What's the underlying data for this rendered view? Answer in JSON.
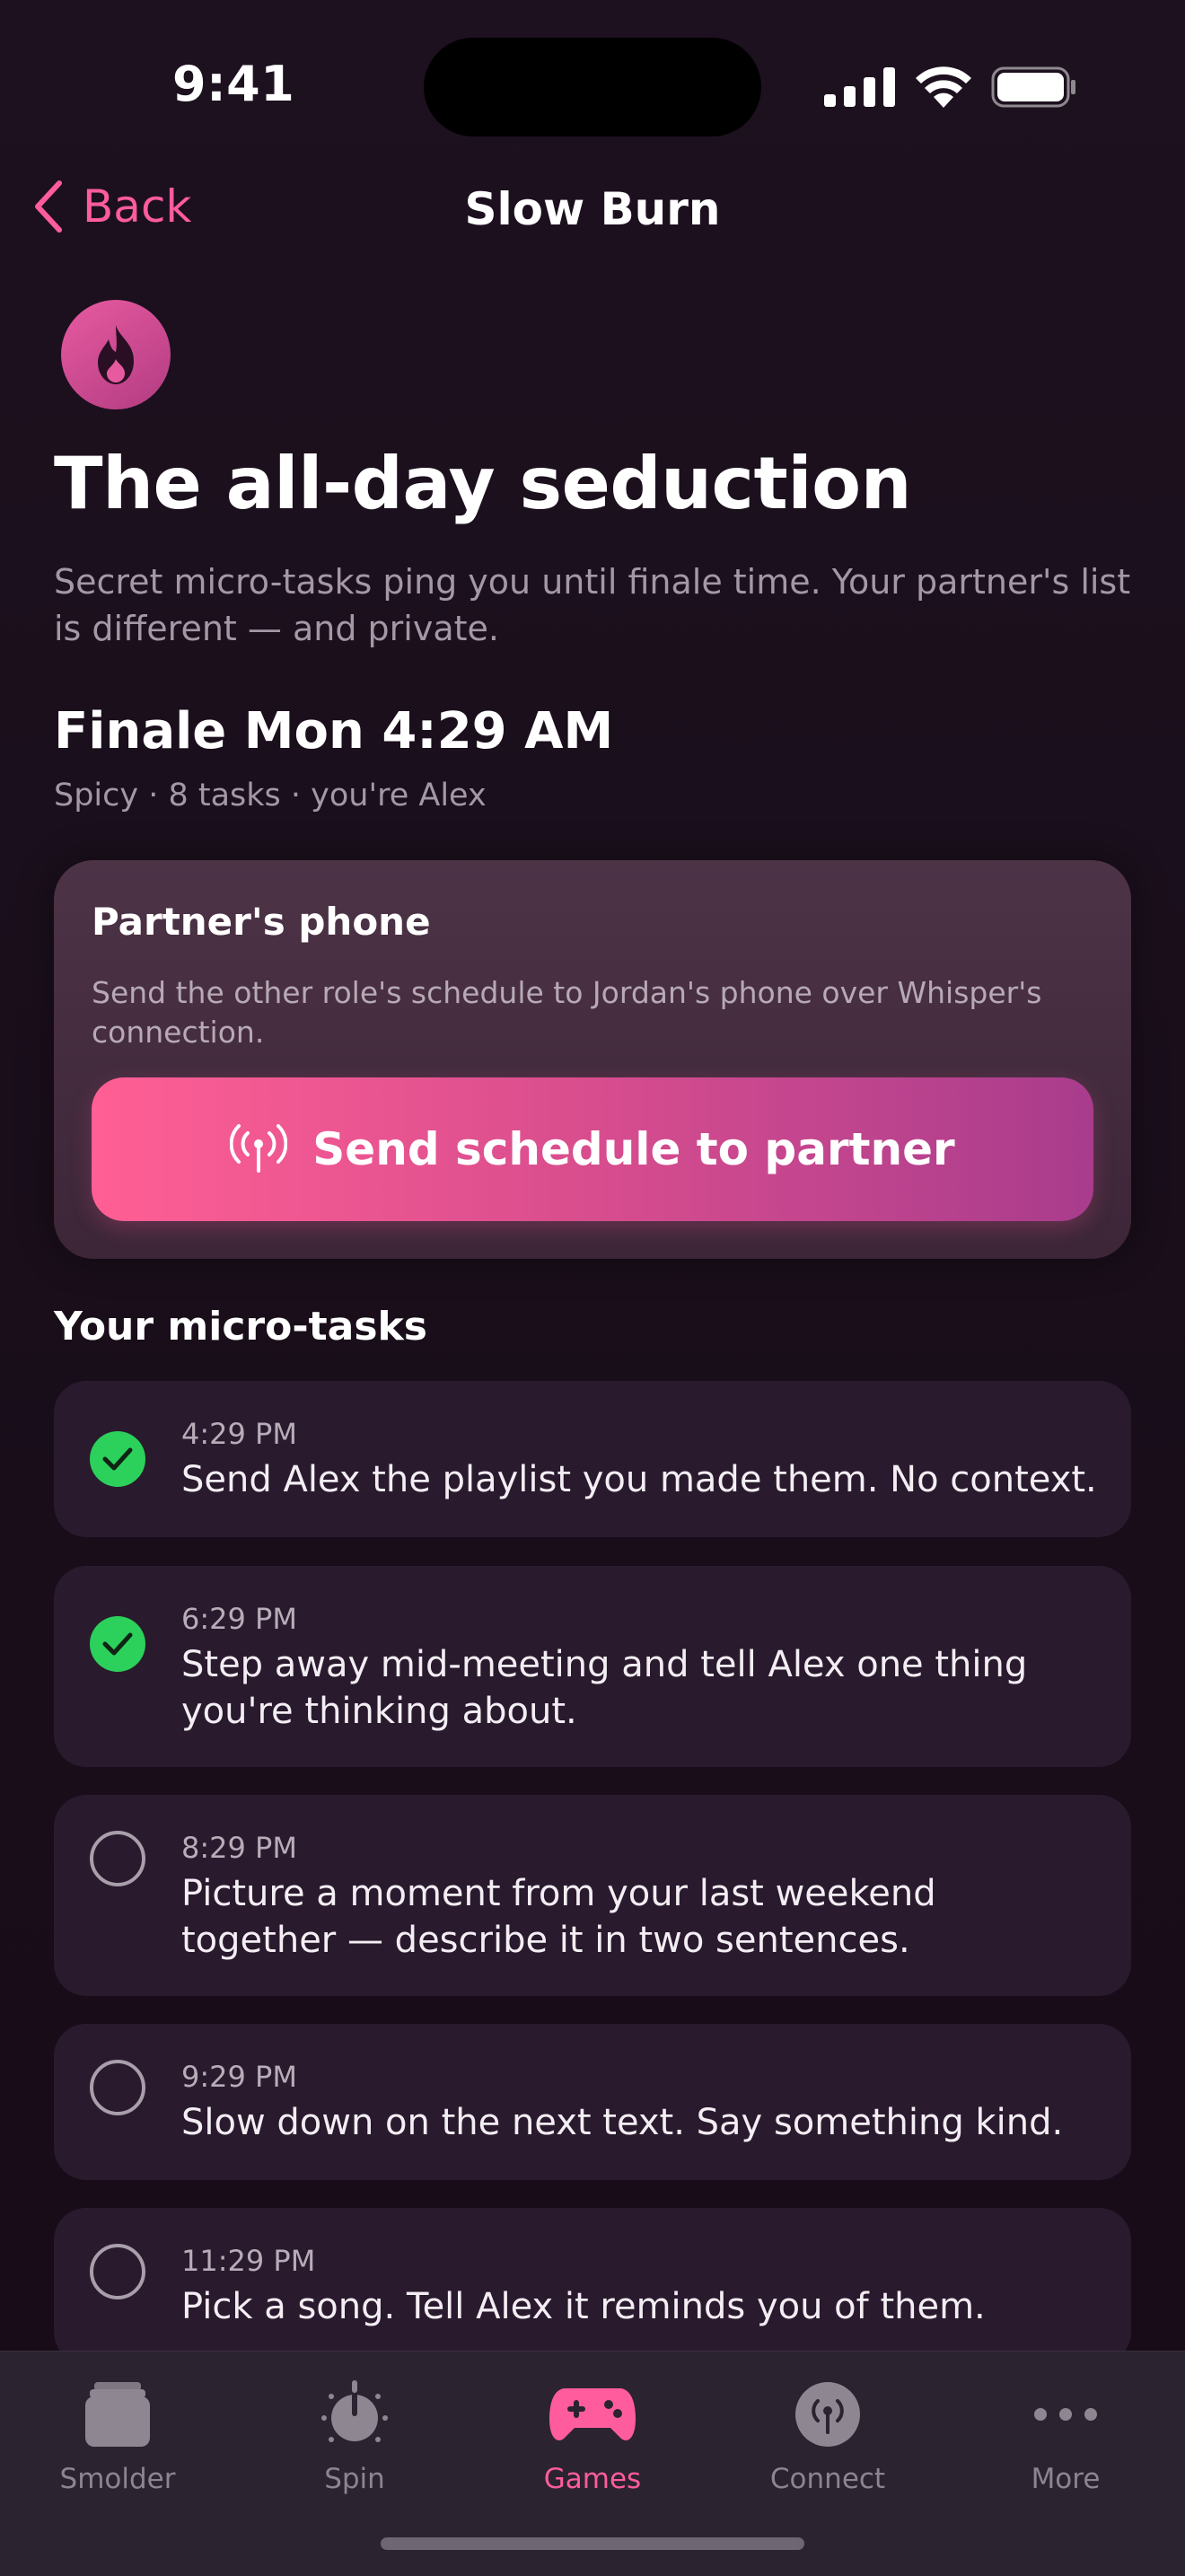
{
  "status_bar": {
    "time": "9:41"
  },
  "nav": {
    "back_label": "Back",
    "title": "Slow Burn"
  },
  "header": {
    "headline": "The all-day seduction",
    "subtitle": "Secret micro-tasks ping you until finale time. Your partner's list is different — and private.",
    "finale": "Finale Mon 4:29 AM",
    "meta": "Spicy · 8 tasks · you're Alex"
  },
  "partner_card": {
    "title": "Partner's phone",
    "description": "Send the other role's schedule to Jordan's phone over Whisper's connection.",
    "button_label": "Send schedule to partner"
  },
  "tasks_section": {
    "title": "Your micro-tasks",
    "tasks": [
      {
        "time": "4:29 PM",
        "text": "Send Alex the playlist you made them. No context.",
        "done": true
      },
      {
        "time": "6:29 PM",
        "text": "Step away mid-meeting and tell Alex one thing you're thinking about.",
        "done": true
      },
      {
        "time": "8:29 PM",
        "text": "Picture a moment from your last weekend together — describe it in two sentences.",
        "done": false
      },
      {
        "time": "9:29 PM",
        "text": "Slow down on the next text. Say something kind.",
        "done": false
      },
      {
        "time": "11:29 PM",
        "text": "Pick a song. Tell Alex it reminds you of them.",
        "done": false
      }
    ]
  },
  "tab_bar": {
    "tabs": [
      {
        "label": "Smolder",
        "icon": "stack-icon",
        "active": false
      },
      {
        "label": "Spin",
        "icon": "timer-icon",
        "active": false
      },
      {
        "label": "Games",
        "icon": "gamepad-icon",
        "active": true
      },
      {
        "label": "Connect",
        "icon": "broadcast-icon",
        "active": false
      },
      {
        "label": "More",
        "icon": "ellipsis-icon",
        "active": false
      }
    ]
  },
  "colors": {
    "accent": "#ff5c9d",
    "background": "#1a0f1c",
    "card": "#2a1a2e",
    "success": "#2bd15a"
  }
}
